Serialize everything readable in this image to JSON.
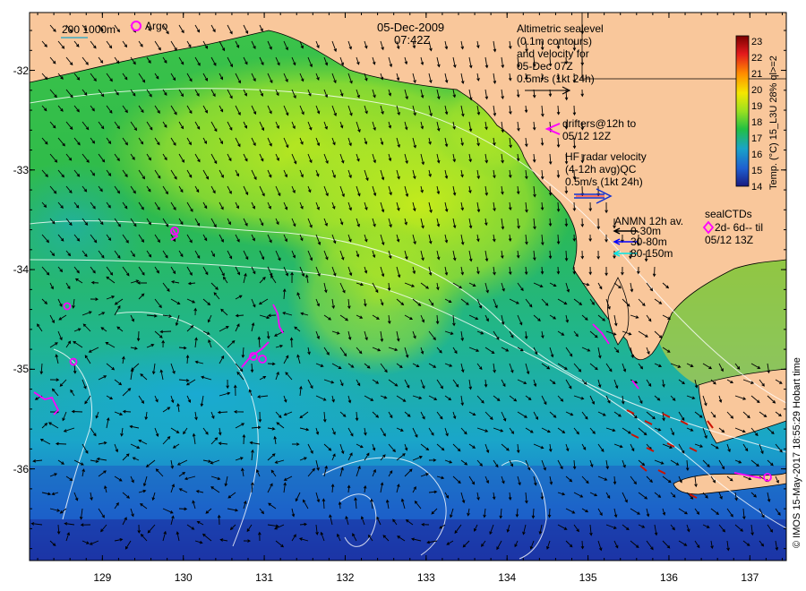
{
  "date": "05-Dec-2009",
  "time": "07:42Z",
  "legend_top_left": {
    "contour_label": "200  1000m",
    "argo_label": "Argo"
  },
  "altimetry": {
    "line1": "Altimetric sealevel",
    "line2": "(0.1m contours)",
    "line3": "and velocity for",
    "line4": "05-Dec 07Z",
    "scale": "0.5m/s (1kt 24h)"
  },
  "drifters": {
    "line1": "drifters@12h to",
    "line2": "05/12 12Z"
  },
  "hf_radar": {
    "line1": "HF radar velocity",
    "line2": "(4-12h avg)QC",
    "line3": "0.5m/s (1kt 24h)"
  },
  "anmn": {
    "title": "ANMN 12h av.",
    "items": [
      {
        "label": "0-30m",
        "color": "#000000"
      },
      {
        "label": "30-80m",
        "color": "#0000ff"
      },
      {
        "label": "80-150m",
        "color": "#00e5e5"
      }
    ]
  },
  "sealctds": {
    "title": "sealCTDs",
    "line2": "2d- 6d-- til",
    "line3": "05/12 13Z"
  },
  "colorbar": {
    "ticks": [
      "23",
      "22",
      "21",
      "20",
      "19",
      "18",
      "17",
      "16",
      "15",
      "14"
    ],
    "label": "Temp. (°C) 15_L3U 28% ql>=2"
  },
  "credit": "© IMOS 15-May-2017 18:55:29 Hobart time",
  "map": {
    "y_ticks": [
      "-32",
      "-33",
      "-34",
      "-35",
      "-36"
    ],
    "y_values": [
      -32,
      -33,
      -34,
      -35,
      -36
    ],
    "x_ticks": [
      "129",
      "130",
      "131",
      "132",
      "133",
      "134",
      "135",
      "136",
      "137"
    ],
    "x_values": [
      129,
      130,
      131,
      132,
      133,
      134,
      135,
      136,
      137
    ],
    "lon_range": [
      128.1,
      137.45
    ],
    "lat_range": [
      -36.92,
      -31.42
    ]
  },
  "colors": {
    "land": "#f9c79b",
    "sst_warm": "#b5e61d",
    "sst_mid": "#22c043",
    "sst_cool": "#1aa3c8",
    "sst_cold": "#1e2ea0",
    "marker": "#ff00ff"
  }
}
